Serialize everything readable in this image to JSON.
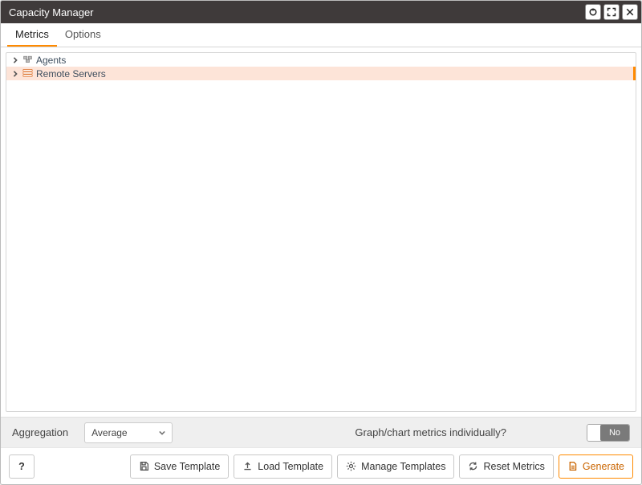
{
  "title": "Capacity Manager",
  "tabs": {
    "metrics": "Metrics",
    "options": "Options"
  },
  "tree": {
    "items": [
      {
        "label": "Agents"
      },
      {
        "label": "Remote Servers"
      }
    ]
  },
  "aggregation": {
    "label": "Aggregation",
    "selected": "Average",
    "graph_individually_label": "Graph/chart metrics individually?",
    "toggle_text": "No"
  },
  "footer": {
    "help": "?",
    "save_template": "Save Template",
    "load_template": "Load Template",
    "manage_templates": "Manage Templates",
    "reset_metrics": "Reset Metrics",
    "generate": "Generate"
  }
}
